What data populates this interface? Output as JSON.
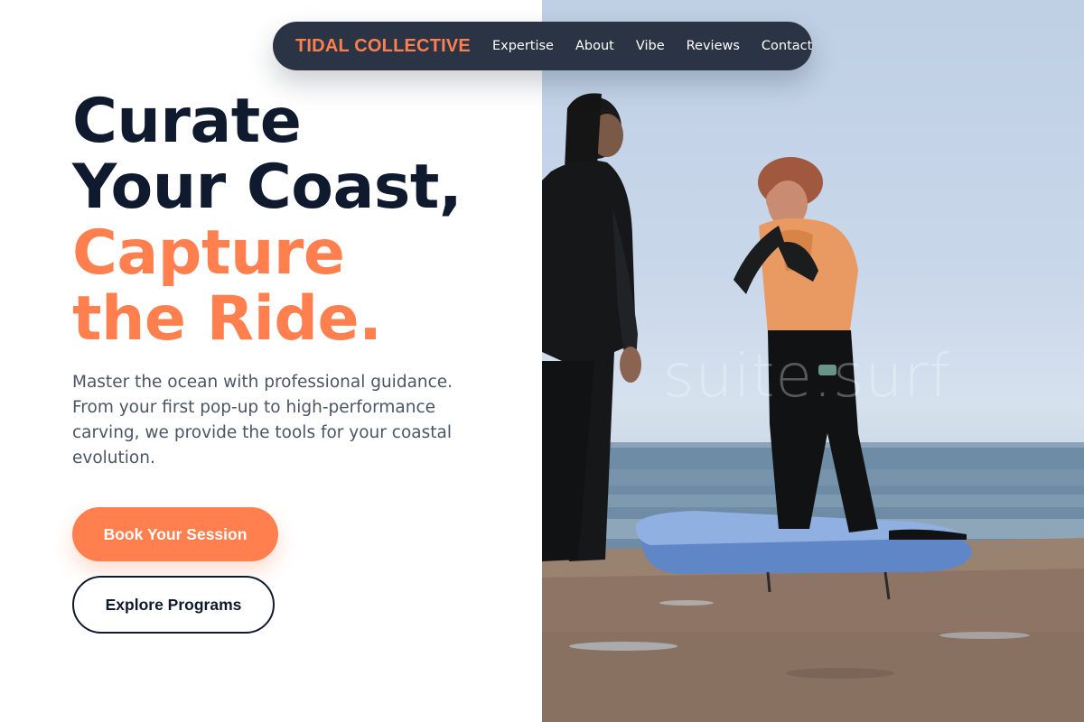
{
  "nav": {
    "brand": "TIDAL COLLECTIVE",
    "links": [
      "Expertise",
      "About",
      "Vibe",
      "Reviews",
      "Contact"
    ]
  },
  "hero": {
    "headline_dark_1": "Curate",
    "headline_dark_2": "Your Coast,",
    "headline_accent_1": "Capture",
    "headline_accent_2": "the Ride.",
    "description": "Master the ocean with professional guidance. From your first pop-up to high-performance carving, we provide the tools for your coastal evolution.",
    "primary_cta": "Book Your Session",
    "secondary_cta": "Explore Programs"
  },
  "photo": {
    "watermark": "suite.surf"
  },
  "colors": {
    "accent": "#ff7f4e",
    "dark": "#101a2e",
    "nav_bg": "#2b3444",
    "body_text": "#4b5565"
  }
}
